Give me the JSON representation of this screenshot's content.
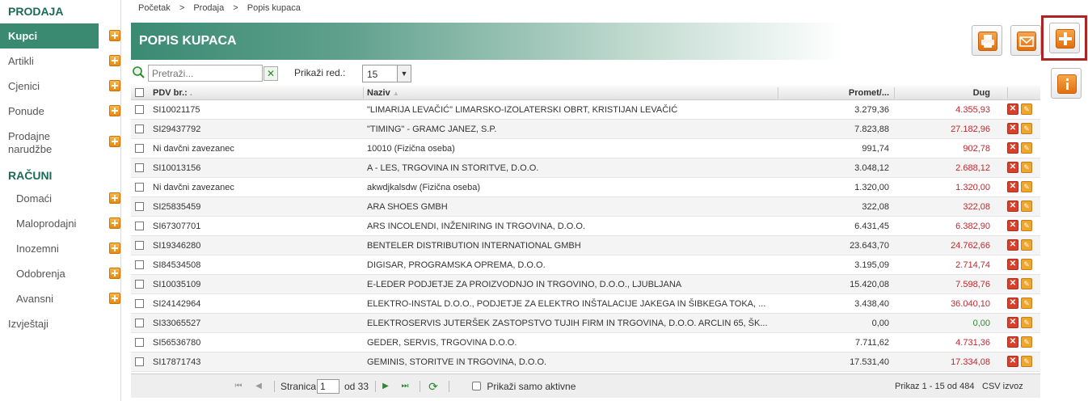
{
  "sidebar": {
    "section1_title": "PRODAJA",
    "section2_title": "RAČUNI",
    "items": [
      {
        "label": "Kupci"
      },
      {
        "label": "Artikli"
      },
      {
        "label": "Cjenici"
      },
      {
        "label": "Ponude"
      },
      {
        "label": "Prodajne narudžbe"
      },
      {
        "label": "Domaći"
      },
      {
        "label": "Maloprodajni"
      },
      {
        "label": "Inozemni"
      },
      {
        "label": "Odobrenja"
      },
      {
        "label": "Avansni"
      },
      {
        "label": "Izvještaji"
      }
    ]
  },
  "breadcrumb": {
    "items": [
      "Početak",
      ">",
      "Prodaja",
      ">",
      "Popis kupaca"
    ]
  },
  "header": {
    "title": "POPIS KUPACA"
  },
  "toolbar": {
    "print_icon": "printer-icon",
    "email_icon": "envelope-icon",
    "add_icon": "plus-icon",
    "info_icon": "info-icon",
    "accent": "#e98a0e",
    "highlight": "#b22222"
  },
  "search": {
    "placeholder": "Pretraži...",
    "rows_label": "Prikaži red.:",
    "rows_value": "15"
  },
  "grid": {
    "columns": {
      "pdv": "PDV br.:",
      "naziv": "Naziv",
      "promet": "Promet/...",
      "dug": "Dug"
    },
    "rows": [
      {
        "pdv": "SI10021175",
        "naziv": "\"LIMARIJA LEVAČIĆ\" LIMARSKO-IZOLATERSKI OBRT, KRISTIJAN LEVAČIĆ",
        "promet": "3.279,36",
        "dug": "4.355,93"
      },
      {
        "pdv": "SI29437792",
        "naziv": "\"TIMING\" - GRAMC JANEZ, S.P.",
        "promet": "7.823,88",
        "dug": "27.182,96"
      },
      {
        "pdv": "Ni davčni zavezanec",
        "naziv": "10010 (Fizična oseba)",
        "promet": "991,74",
        "dug": "902,78"
      },
      {
        "pdv": "SI10013156",
        "naziv": "A - LES, TRGOVINA IN STORITVE, D.O.O.",
        "promet": "3.048,12",
        "dug": "2.688,12"
      },
      {
        "pdv": "Ni davčni zavezanec",
        "naziv": "akwdjkalsdw (Fizična oseba)",
        "promet": "1.320,00",
        "dug": "1.320,00"
      },
      {
        "pdv": "SI25835459",
        "naziv": "ARA SHOES GMBH",
        "promet": "322,08",
        "dug": "322,08"
      },
      {
        "pdv": "SI67307701",
        "naziv": "ARS INCOLENDI, INŽENIRING IN TRGOVINA, D.O.O.",
        "promet": "6.431,45",
        "dug": "6.382,90"
      },
      {
        "pdv": "SI19346280",
        "naziv": "BENTELER DISTRIBUTION INTERNATIONAL GMBH",
        "promet": "23.643,70",
        "dug": "24.762,66"
      },
      {
        "pdv": "SI84534508",
        "naziv": "DIGISAR, PROGRAMSKA OPREMA, D.O.O.",
        "promet": "3.195,09",
        "dug": "2.714,74"
      },
      {
        "pdv": "SI10035109",
        "naziv": "E-LEDER PODJETJE ZA PROIZVODNJO IN TRGOVINO, D.O.O., LJUBLJANA",
        "promet": "15.420,08",
        "dug": "7.598,76"
      },
      {
        "pdv": "SI24142964",
        "naziv": "ELEKTRO-INSTAL D.O.O., PODJETJE ZA ELEKTRO INŠTALACIJE JAKEGA IN ŠIBKEGA TOKA, ...",
        "promet": "3.438,40",
        "dug": "36.040,10"
      },
      {
        "pdv": "SI33065527",
        "naziv": "ELEKTROSERVIS JUTERŠEK ZASTOPSTVO TUJIH FIRM IN TRGOVINA, D.O.O. ARCLIN 65, ŠK...",
        "promet": "0,00",
        "dug": "0,00"
      },
      {
        "pdv": "SI56536780",
        "naziv": "GEDER, SERVIS, TRGOVINA D.O.O.",
        "promet": "7.711,62",
        "dug": "4.731,36"
      },
      {
        "pdv": "SI17871743",
        "naziv": "GEMINIS, STORITVE IN TRGOVINA, D.O.O.",
        "promet": "17.531,40",
        "dug": "17.334,08"
      }
    ]
  },
  "pager": {
    "page_label": "Stranica",
    "page_value": "1",
    "of_label": "od 33",
    "active_only_label": "Prikaži samo aktivne",
    "summary": "Prikaz 1 - 15 od 484",
    "csv_label": "CSV izvoz"
  }
}
